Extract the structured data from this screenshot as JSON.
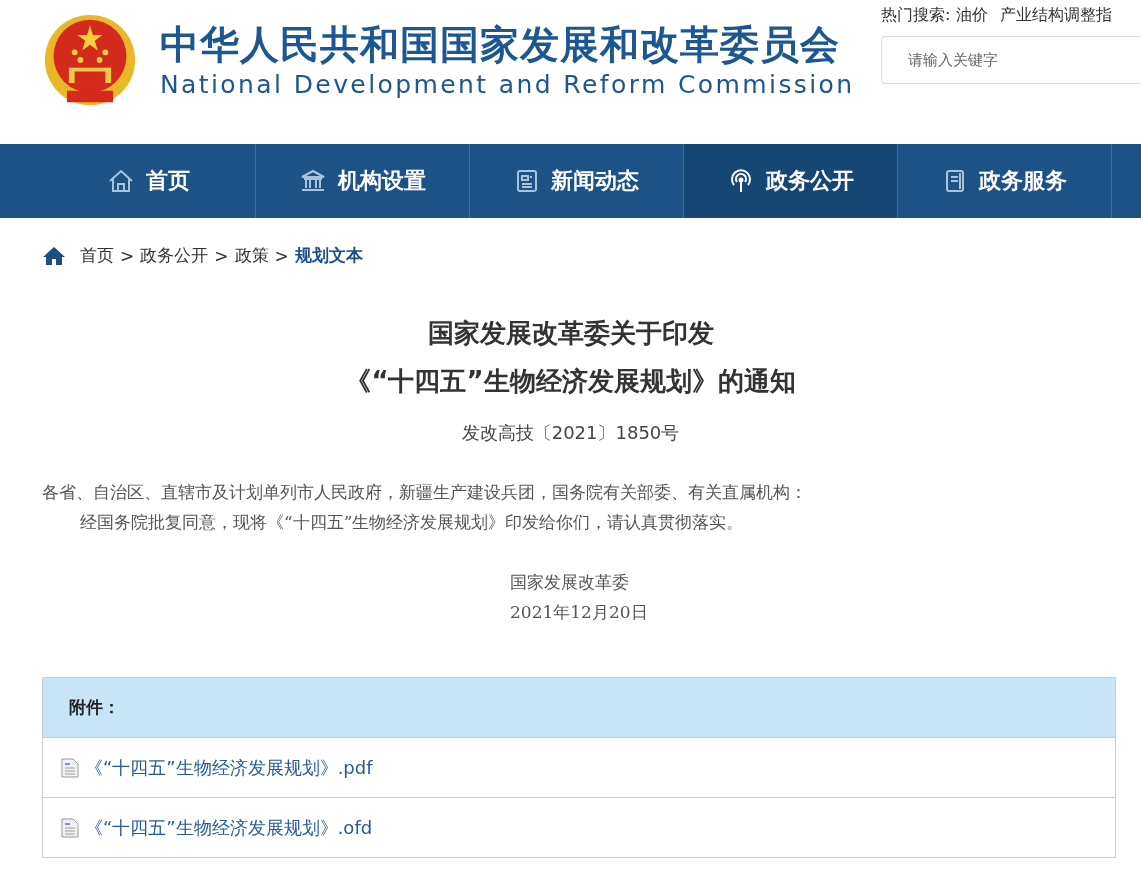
{
  "header": {
    "site_title": "中华人民共和国国家发展和改革委员会",
    "site_subtitle": "National Development and Reform Commission",
    "hot_search_label": "热门搜索:",
    "hot_search_terms": [
      "油价",
      "产业结构调整指"
    ],
    "search": {
      "placeholder": "请输入关键字"
    }
  },
  "nav": [
    {
      "label": "首页",
      "kind": "house",
      "selected": false
    },
    {
      "label": "机构设置",
      "kind": "building",
      "selected": false
    },
    {
      "label": "新闻动态",
      "kind": "news",
      "selected": false
    },
    {
      "label": "政务公开",
      "kind": "signal",
      "selected": true
    },
    {
      "label": "政务服务",
      "kind": "doc",
      "selected": false
    }
  ],
  "breadcrumb": [
    {
      "kind": "link",
      "label": "首页",
      "current": false
    },
    {
      "kind": "separator",
      "label": ">"
    },
    {
      "kind": "link",
      "label": "政务公开",
      "current": false
    },
    {
      "kind": "separator",
      "label": ">"
    },
    {
      "kind": "link",
      "label": "政策",
      "current": false
    },
    {
      "kind": "separator",
      "label": ">"
    },
    {
      "kind": "link",
      "label": "规划文本",
      "current": true
    }
  ],
  "article": {
    "title_lines": [
      "国家发展改革委关于印发",
      "《“十四五”生物经济发展规划》的通知"
    ],
    "doc_number": "发改高技〔2021〕1850号",
    "addressee": "各省、自治区、直辖市及计划单列市人民政府，新疆生产建设兵团，国务院有关部委、有关直属机构：",
    "body": "经国务院批复同意，现将《“十四五”生物经济发展规划》印发给你们，请认真贯彻落实。",
    "signature": "国家发展改革委",
    "date": "2021年12月20日"
  },
  "attachments": {
    "heading": "附件：",
    "files": [
      "《“十四五”生物经济发展规划》.pdf",
      "《“十四五”生物经济发展规划》.ofd"
    ]
  }
}
